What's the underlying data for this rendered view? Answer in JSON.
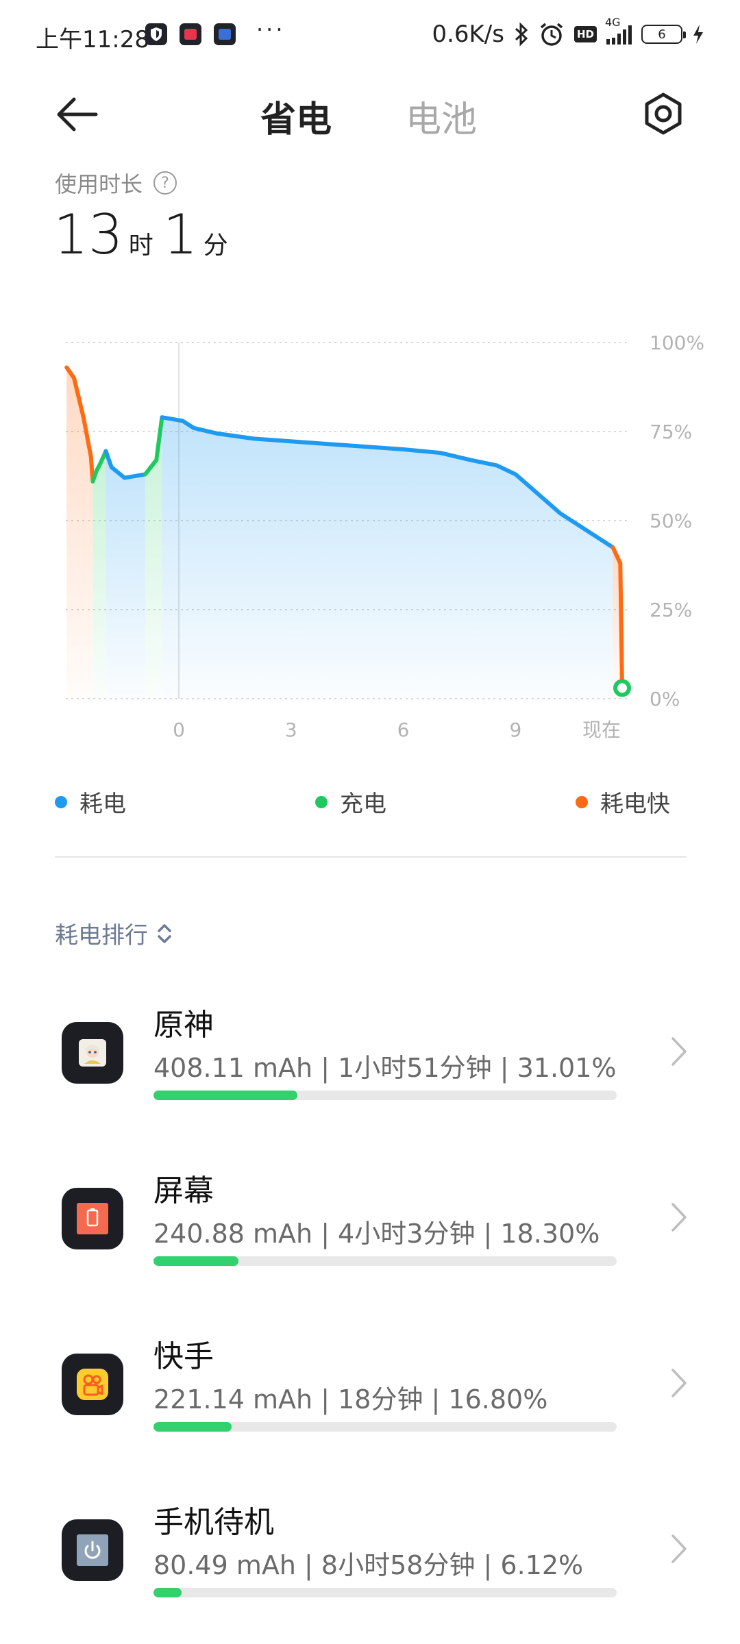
{
  "status_bar": {
    "time": "上午11:28",
    "more": "···",
    "net_speed": "0.6K/s",
    "hd": "HD",
    "net_type": "4G",
    "battery_level": "6"
  },
  "header": {
    "tab_active": "省电",
    "tab_inactive": "电池"
  },
  "usage": {
    "label": "使用时长",
    "help": "?",
    "hours": "13",
    "hours_unit": "时",
    "minutes": "1",
    "minutes_unit": "分"
  },
  "chart_data": {
    "type": "line",
    "y_ticks": [
      "100%",
      "75%",
      "50%",
      "25%",
      "0%"
    ],
    "x_ticks": [
      "0",
      "3",
      "6",
      "9",
      "现在"
    ],
    "ylim": [
      0,
      100
    ],
    "legend": [
      {
        "label": "耗电",
        "color": "#1e9bf0"
      },
      {
        "label": "充电",
        "color": "#1ec95f"
      },
      {
        "label": "耗电快",
        "color": "#ff6a13"
      }
    ],
    "segments": [
      {
        "kind": "耗电快",
        "color": "#ff6a13",
        "points": [
          [
            -3.0,
            93
          ],
          [
            -2.8,
            90
          ],
          [
            -2.55,
            79
          ],
          [
            -2.35,
            68
          ],
          [
            -2.3,
            61
          ]
        ]
      },
      {
        "kind": "充电",
        "color": "#1ec95f",
        "points": [
          [
            -2.3,
            61
          ],
          [
            -2.2,
            64
          ],
          [
            -2.1,
            66
          ],
          [
            -1.95,
            69.5
          ]
        ]
      },
      {
        "kind": "耗电",
        "color": "#1e9bf0",
        "points": [
          [
            -1.95,
            69.5
          ],
          [
            -1.8,
            65
          ],
          [
            -1.45,
            62
          ],
          [
            -0.9,
            63
          ]
        ]
      },
      {
        "kind": "充电",
        "color": "#1ec95f",
        "points": [
          [
            -0.9,
            63
          ],
          [
            -0.6,
            67
          ],
          [
            -0.45,
            79
          ]
        ]
      },
      {
        "kind": "耗电",
        "color": "#1e9bf0",
        "points": [
          [
            -0.45,
            79
          ],
          [
            0.1,
            78
          ],
          [
            0.4,
            76
          ],
          [
            1.0,
            74.5
          ],
          [
            2.0,
            73
          ],
          [
            4.0,
            71.5
          ],
          [
            6.0,
            70
          ],
          [
            7.0,
            69
          ],
          [
            7.8,
            67
          ],
          [
            8.5,
            65.5
          ],
          [
            9.0,
            63
          ],
          [
            10.2,
            52
          ],
          [
            11.6,
            42.5
          ]
        ]
      },
      {
        "kind": "耗电快",
        "color": "#ff6a13",
        "points": [
          [
            11.6,
            42.5
          ],
          [
            11.8,
            38
          ],
          [
            11.85,
            3
          ]
        ]
      }
    ],
    "current_point": [
      11.85,
      3
    ]
  },
  "legend": {
    "drain": "耗电",
    "charge": "充电",
    "fast_drain": "耗电快"
  },
  "ranking": {
    "title": "耗电排行",
    "items": [
      {
        "name": "原神",
        "detail": "408.11 mAh | 1小时51分钟 | 31.01%",
        "percent": 31.01,
        "icon": "genshin-icon"
      },
      {
        "name": "屏幕",
        "detail": "240.88 mAh | 4小时3分钟 | 18.30%",
        "percent": 18.3,
        "icon": "screen-icon"
      },
      {
        "name": "快手",
        "detail": "221.14 mAh | 18分钟 | 16.80%",
        "percent": 16.8,
        "icon": "kuaishou-icon"
      },
      {
        "name": "手机待机",
        "detail": "80.49 mAh | 8小时58分钟 | 6.12%",
        "percent": 6.12,
        "icon": "power-icon"
      }
    ]
  }
}
